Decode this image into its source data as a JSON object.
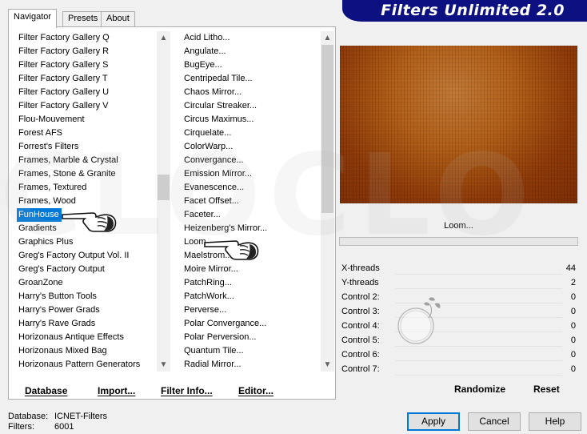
{
  "banner": {
    "title": "Filters Unlimited 2.0"
  },
  "tabs": [
    {
      "label": "Navigator",
      "active": true
    },
    {
      "label": "Presets",
      "active": false
    },
    {
      "label": "About",
      "active": false
    }
  ],
  "categories": {
    "items": [
      "Filter Factory Gallery Q",
      "Filter Factory Gallery R",
      "Filter Factory Gallery S",
      "Filter Factory Gallery T",
      "Filter Factory Gallery U",
      "Filter Factory Gallery V",
      "Flou-Mouvement",
      "Forest AFS",
      "Forrest's Filters",
      "Frames, Marble & Crystal",
      "Frames, Stone & Granite",
      "Frames, Textured",
      "Frames, Wood",
      "FunHouse",
      "Gradients",
      "Graphics Plus",
      "Greg's Factory Output Vol. II",
      "Greg's Factory Output",
      "GroanZone",
      "Harry's Button Tools",
      "Harry's Power Grads",
      "Harry's Rave Grads",
      "Horizonaus Antique Effects",
      "Horizonaus Mixed Bag",
      "Horizonaus Pattern Generators"
    ],
    "selected": "FunHouse",
    "scroll_position": 0.45
  },
  "filters": {
    "items": [
      "Acid Litho...",
      "Angulate...",
      "BugEye...",
      "Centripedal Tile...",
      "Chaos Mirror...",
      "Circular Streaker...",
      "Circus Maximus...",
      "Cirquelate...",
      "ColorWarp...",
      "Convergance...",
      "Emission Mirror...",
      "Evanescence...",
      "Facet Offset...",
      "Faceter...",
      "Heizenberg's Mirror...",
      "Loom...",
      "Maelstrom...",
      "Moire Mirror...",
      "PatchRing...",
      "PatchWork...",
      "Perverse...",
      "Polar Convergance...",
      "Polar Perversion...",
      "Quantum Tile...",
      "Radial Mirror..."
    ],
    "scroll_position": 0.0
  },
  "bottom_buttons": {
    "database": "Database",
    "import": "Import...",
    "filter_info": "Filter Info...",
    "editor": "Editor..."
  },
  "preview": {
    "filter_name": "Loom..."
  },
  "params": [
    {
      "label": "X-threads",
      "value": "44"
    },
    {
      "label": "Y-threads",
      "value": "2"
    },
    {
      "label": "Control 2:",
      "value": "0"
    },
    {
      "label": "Control 3:",
      "value": "0"
    },
    {
      "label": "Control 4:",
      "value": "0"
    },
    {
      "label": "Control 5:",
      "value": "0"
    },
    {
      "label": "Control 6:",
      "value": "0"
    },
    {
      "label": "Control 7:",
      "value": "0"
    }
  ],
  "right_buttons": {
    "randomize": "Randomize",
    "reset": "Reset"
  },
  "status": {
    "database_label": "Database:",
    "database_value": "ICNET-Filters",
    "filters_label": "Filters:",
    "filters_value": "6001"
  },
  "dialog_buttons": {
    "apply": "Apply",
    "cancel": "Cancel",
    "help": "Help"
  },
  "watermark": {
    "text": "CLOCLO"
  },
  "colors": {
    "selection": "#0078d7",
    "banner": "#0c1080"
  },
  "icons": [
    "pointing-hand-icon",
    "up-arrow-icon",
    "down-arrow-icon",
    "cloclo-logo-icon"
  ]
}
